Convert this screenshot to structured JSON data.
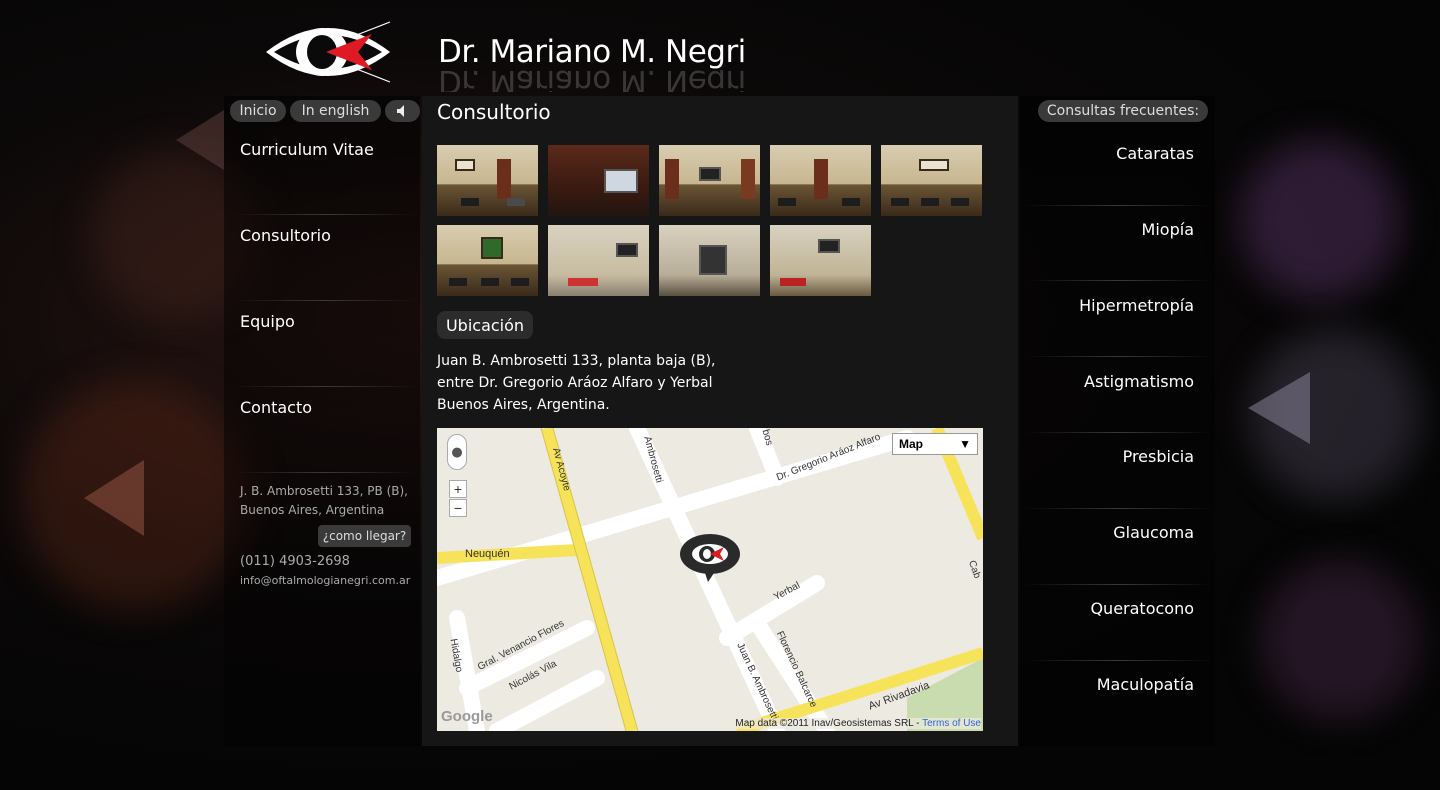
{
  "header": {
    "title": "Dr. Mariano M. Negri"
  },
  "topnav": {
    "inicio": "Inicio",
    "english": "In english",
    "sound_icon": "speaker-icon"
  },
  "sidebar": {
    "items": [
      {
        "label": "Curriculum Vitae"
      },
      {
        "label": "Consultorio"
      },
      {
        "label": "Equipo"
      },
      {
        "label": "Contacto"
      }
    ],
    "address_line1": "J. B. Ambrosetti 133, PB (B),",
    "address_line2": "Buenos Aires, Argentina",
    "como_llegar": "¿como llegar?",
    "phone": "(011) 4903-2698",
    "email": "info@oftalmologianegri.com.ar"
  },
  "main": {
    "section_title": "Consultorio",
    "ubicacion_label": "Ubicación",
    "address": [
      "Juan B. Ambrosetti 133, planta baja (B),",
      "entre Dr. Gregorio Aráoz Alfaro y Yerbal",
      "Buenos Aires, Argentina."
    ],
    "thumbnail_count": 9
  },
  "map": {
    "type_label": "Map",
    "credit": "Map data ©2011 Inav/Geosistemas SRL - ",
    "terms": "Terms of Use",
    "google_logo": "Google",
    "streets": {
      "acoyte": "Av Acoyte",
      "ambrosetti_top": "Ambrosetti",
      "gregorio": "Dr. Gregorio Aráoz Alfaro",
      "neuquen": "Neuquén",
      "yerbal": "Yerbal",
      "venancio": "Gral. Venancio Flores",
      "nicolas": "Nicolás Vila",
      "hidalgo": "Hidalgo",
      "ambrosetti_bottom": "Juan B. Ambrosetti",
      "florencio": "Florencio Balcarce",
      "rivadavia": "Av Rivadavia",
      "bos": "bos",
      "cab": "Cab"
    }
  },
  "faq": {
    "title": "Consultas frecuentes:",
    "items": [
      {
        "label": "Cataratas"
      },
      {
        "label": "Miopía"
      },
      {
        "label": "Hipermetropía"
      },
      {
        "label": "Astigmatismo"
      },
      {
        "label": "Presbicia"
      },
      {
        "label": "Glaucoma"
      },
      {
        "label": "Queratocono"
      },
      {
        "label": "Maculopatía"
      }
    ]
  },
  "colors": {
    "accent": "#e01a22",
    "map_road": "#f7e35a",
    "pill": "#3a3a3a"
  }
}
